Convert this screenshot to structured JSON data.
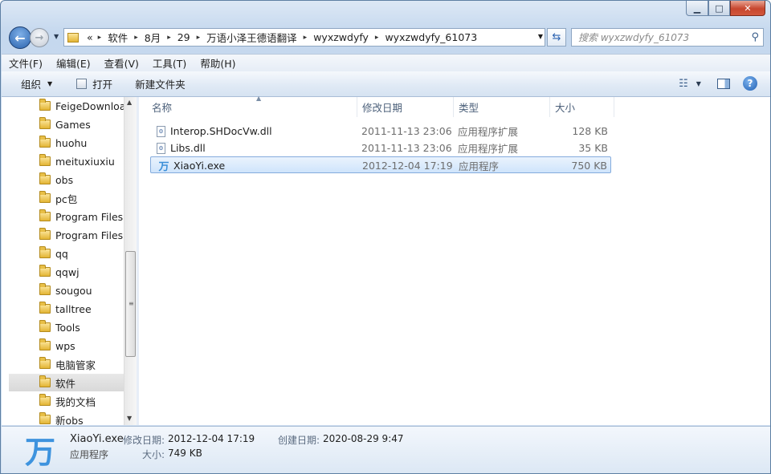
{
  "address": {
    "overflow": "«",
    "segments": [
      "软件",
      "8月",
      "29",
      "万语小泽王德语翻译",
      "wyxzwdyfy",
      "wyxzwdyfy_61073"
    ]
  },
  "search": {
    "placeholder": "搜索 wyxzwdyfy_61073"
  },
  "menu": [
    "文件(F)",
    "编辑(E)",
    "查看(V)",
    "工具(T)",
    "帮助(H)"
  ],
  "toolbar": {
    "organize": "组织",
    "open": "打开",
    "new_folder": "新建文件夹"
  },
  "nav_items": [
    {
      "label": "FeigeDownloa"
    },
    {
      "label": "Games"
    },
    {
      "label": "huohu"
    },
    {
      "label": "meituxiuxiu"
    },
    {
      "label": "obs"
    },
    {
      "label": "pc包"
    },
    {
      "label": "Program Files"
    },
    {
      "label": "Program Files"
    },
    {
      "label": "qq"
    },
    {
      "label": "qqwj"
    },
    {
      "label": "sougou"
    },
    {
      "label": "talltree"
    },
    {
      "label": "Tools"
    },
    {
      "label": "wps"
    },
    {
      "label": "电脑管家"
    },
    {
      "label": "软件",
      "selected": true
    },
    {
      "label": "我的文档"
    },
    {
      "label": "新obs"
    }
  ],
  "columns": {
    "name": "名称",
    "modified": "修改日期",
    "type": "类型",
    "size": "大小"
  },
  "files": [
    {
      "name": "Interop.SHDocVw.dll",
      "modified": "2011-11-13 23:06",
      "type": "应用程序扩展",
      "size": "128 KB",
      "icon": "dll-file-icon"
    },
    {
      "name": "Libs.dll",
      "modified": "2011-11-13 23:06",
      "type": "应用程序扩展",
      "size": "35 KB",
      "icon": "dll-file-icon"
    },
    {
      "name": "XiaoYi.exe",
      "modified": "2012-12-04 17:19",
      "type": "应用程序",
      "size": "750 KB",
      "icon": "app-icon",
      "selected": true
    }
  ],
  "details": {
    "icon_glyph": "万",
    "name": "XiaoYi.exe",
    "type": "应用程序",
    "modified_label": "修改日期:",
    "modified": "2012-12-04 17:19",
    "created_label": "创建日期:",
    "created": "2020-08-29 9:47",
    "size_label": "大小:",
    "size": "749 KB"
  },
  "file_icon_glyph": "万"
}
